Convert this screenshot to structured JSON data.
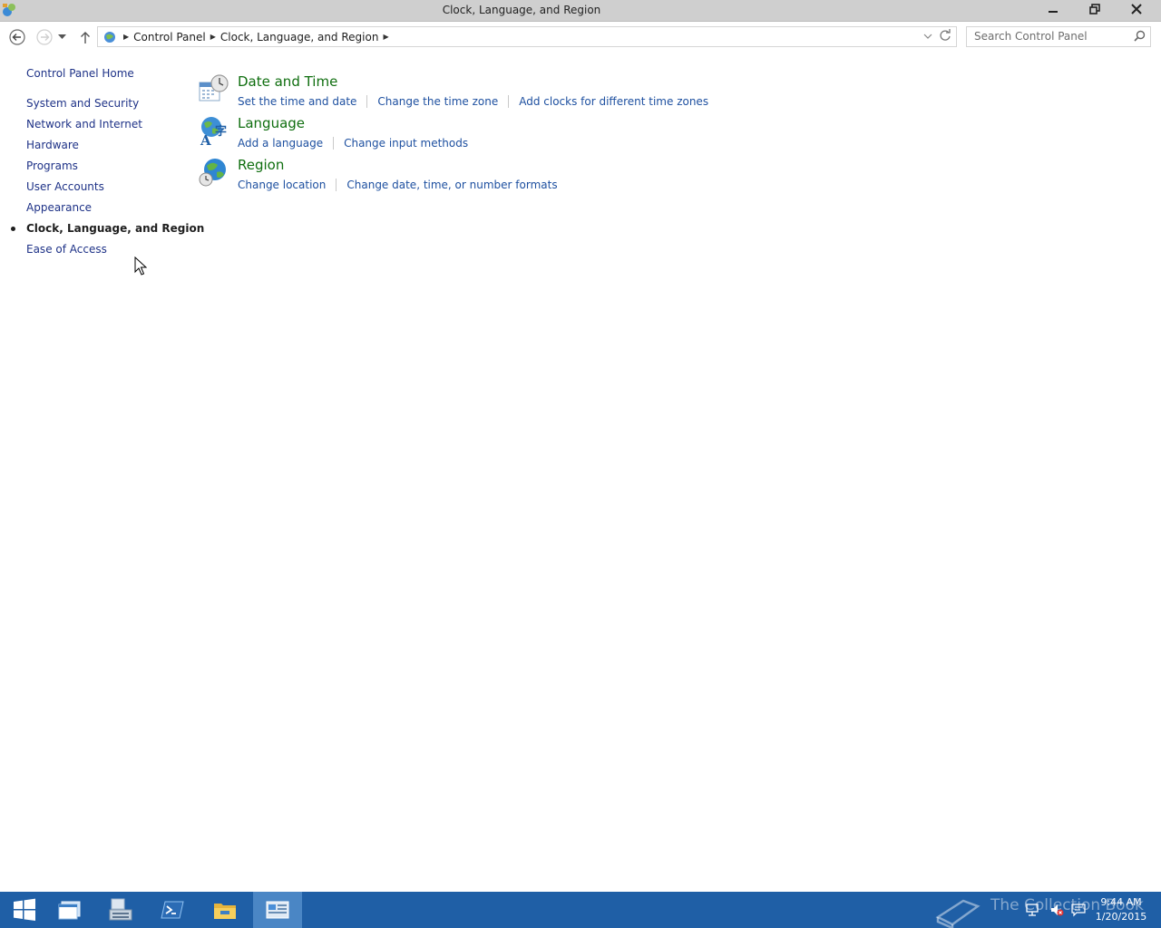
{
  "window": {
    "title": "Clock, Language, and Region"
  },
  "address": {
    "crumbs": [
      "Control Panel",
      "Clock, Language, and Region"
    ]
  },
  "search": {
    "placeholder": "Search Control Panel"
  },
  "leftnav": {
    "home": "Control Panel Home",
    "items": [
      {
        "label": "System and Security"
      },
      {
        "label": "Network and Internet"
      },
      {
        "label": "Hardware"
      },
      {
        "label": "Programs"
      },
      {
        "label": "User Accounts"
      },
      {
        "label": "Appearance"
      },
      {
        "label": "Clock, Language, and Region",
        "active": true
      },
      {
        "label": "Ease of Access"
      }
    ]
  },
  "categories": [
    {
      "title": "Date and Time",
      "icon": "calendar-clock-icon",
      "links": [
        "Set the time and date",
        "Change the time zone",
        "Add clocks for different time zones"
      ]
    },
    {
      "title": "Language",
      "icon": "language-globe-icon",
      "links": [
        "Add a language",
        "Change input methods"
      ]
    },
    {
      "title": "Region",
      "icon": "region-globe-icon",
      "links": [
        "Change location",
        "Change date, time, or number formats"
      ]
    }
  ],
  "taskbar": {
    "watermark": "The Collection Book",
    "time": "9:44 AM",
    "date": "1/20/2015"
  },
  "colors": {
    "link": "#1e50a0",
    "category_title": "#0f6e0f",
    "taskbar": "#1f5fa6"
  }
}
